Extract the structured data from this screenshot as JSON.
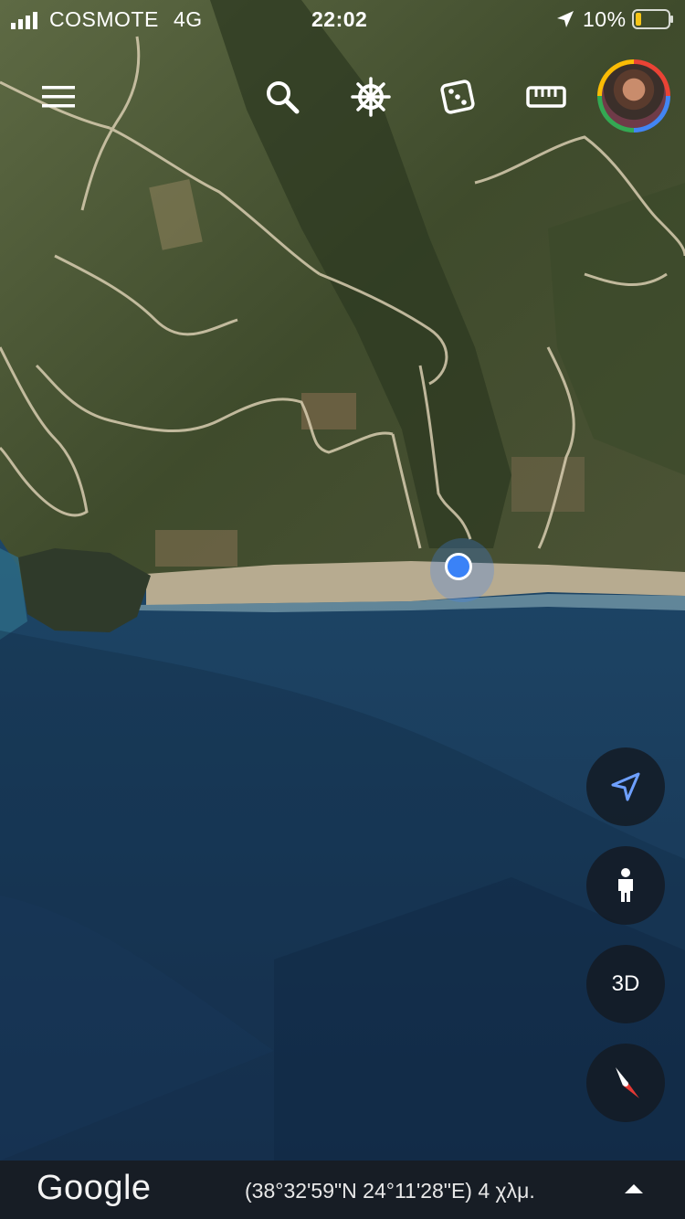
{
  "status_bar": {
    "carrier": "COSMOTE",
    "network": "4G",
    "time": "22:02",
    "battery": "10%"
  },
  "toolbar": {
    "menu_icon": "hamburger-menu-icon",
    "search_icon": "search-icon",
    "voyager_icon": "ship-wheel-icon",
    "feeling_lucky_icon": "dice-icon",
    "measure_icon": "ruler-icon"
  },
  "map_controls": {
    "my_location_icon": "navigation-arrow-icon",
    "street_view_icon": "pegman-icon",
    "toggle_3d_label": "3D",
    "compass_icon": "compass-icon"
  },
  "bottom_bar": {
    "logo": "Google",
    "coordinates": "(38°32'59\"N 24°11'28\"E) 4 χλμ.",
    "expand_icon": "caret-up-icon"
  },
  "colors": {
    "sea": "#1f4a6b",
    "land": "#4e5a37",
    "accent_blue": "#3a82f7",
    "fab_bg": "#141a22"
  }
}
